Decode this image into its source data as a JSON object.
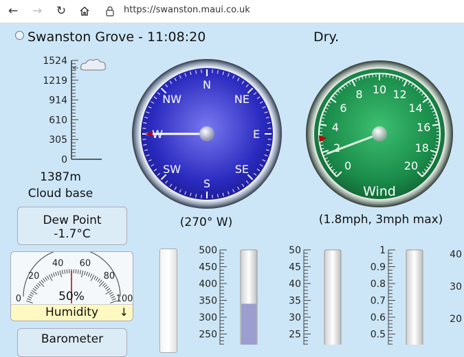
{
  "browser": {
    "url": "https://swanston.maui.co.uk",
    "back_icon": "arrow-left-icon",
    "forward_icon": "arrow-right-icon",
    "reload_icon": "reload-icon",
    "home_icon": "home-icon",
    "lock_icon": "lock-icon"
  },
  "header": {
    "station_title": "Swanston Grove - 11:08:20",
    "condition": "Dry."
  },
  "cloudbase": {
    "ticks": [
      "1524",
      "1219",
      "914",
      "610",
      "305",
      "0"
    ],
    "value_text": "1387m",
    "label": "Cloud base",
    "value": 1387,
    "max": 1524
  },
  "compass": {
    "directions": [
      "N",
      "NE",
      "E",
      "SE",
      "S",
      "SW",
      "W",
      "NW"
    ],
    "bearing": 270,
    "caption": "(270° W)",
    "color": "#2020b0"
  },
  "wind": {
    "ticks": [
      "0",
      "2",
      "4",
      "6",
      "8",
      "10",
      "12",
      "14",
      "16",
      "18",
      "20"
    ],
    "label": "Wind",
    "speed": 1.8,
    "max": 3,
    "scale_max": 20,
    "caption": "(1.8mph, 3mph max)",
    "color": "#1a8a4a"
  },
  "dewpoint": {
    "label": "Dew Point",
    "value": "-1.7°C"
  },
  "humidity": {
    "ticks": [
      "0",
      "20",
      "40",
      "60",
      "80",
      "100"
    ],
    "value": 50,
    "value_text": "50%",
    "label": "Humidity",
    "trend_icon": "arrow-down-icon",
    "trend_text": "↓"
  },
  "barometer": {
    "label": "Barometer"
  },
  "bars": {
    "bar2_ticks": [
      "500",
      "450",
      "400",
      "350",
      "300",
      "250"
    ],
    "bar2_value": 340,
    "bar3_ticks": [
      "50",
      "45",
      "40",
      "35",
      "30",
      "25"
    ],
    "bar4_ticks": [
      "1",
      "0.9",
      "0.8",
      "0.7",
      "0.6",
      "0.5"
    ],
    "bar5_ticks": [
      "40",
      "30",
      "20"
    ]
  }
}
